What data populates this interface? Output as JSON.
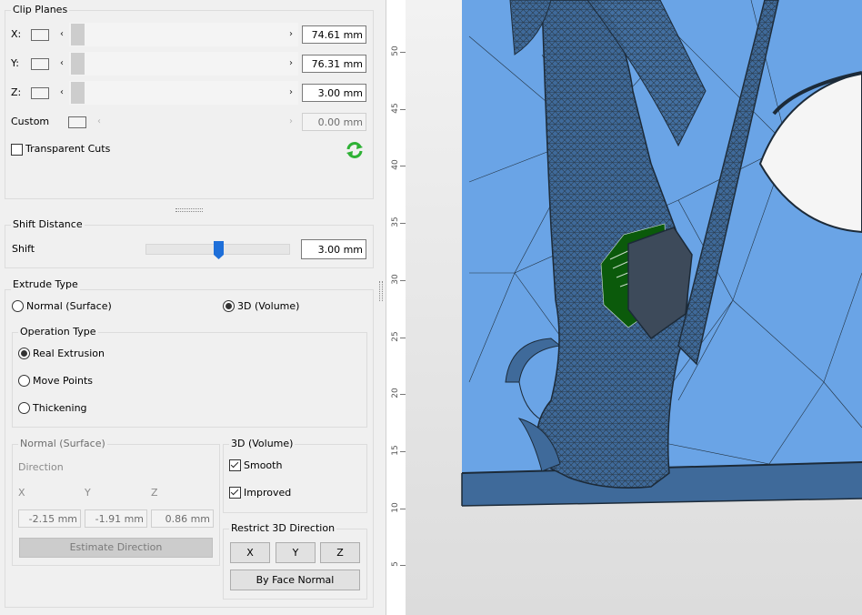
{
  "clip_planes": {
    "title": "Clip Planes",
    "rows": [
      {
        "label": "X:",
        "value": "74.61 mm"
      },
      {
        "label": "Y:",
        "value": "76.31 mm"
      },
      {
        "label": "Z:",
        "value": "3.00 mm"
      },
      {
        "label": "Custom",
        "value": "0.00 mm"
      }
    ],
    "transparent_cuts_label": "Transparent Cuts",
    "transparent_cuts_checked": false
  },
  "shift_distance": {
    "title": "Shift Distance",
    "shift_label": "Shift",
    "value": "3.00 mm"
  },
  "extrude_type": {
    "title": "Extrude Type",
    "normal_label": "Normal (Surface)",
    "volume_label": "3D (Volume)",
    "selected": "3D (Volume)"
  },
  "operation_type": {
    "title": "Operation Type",
    "options": [
      "Real Extrusion",
      "Move Points",
      "Thickening"
    ],
    "selected": "Real Extrusion"
  },
  "normal_surface": {
    "title": "Normal (Surface)",
    "direction_label": "Direction",
    "x_label": "X",
    "y_label": "Y",
    "z_label": "Z",
    "x_value": "-2.15 mm",
    "y_value": "-1.91 mm",
    "z_value": "0.86 mm",
    "estimate_label": "Estimate Direction"
  },
  "volume_options": {
    "title": "3D (Volume)",
    "smooth_label": "Smooth",
    "smooth_checked": true,
    "improved_label": "Improved",
    "improved_checked": true
  },
  "restrict_direction": {
    "title": "Restrict 3D Direction",
    "x_label": "X",
    "y_label": "Y",
    "z_label": "Z",
    "by_face_label": "By Face Normal"
  },
  "ruler": {
    "ticks": [
      "50",
      "45",
      "40",
      "35",
      "30",
      "25",
      "20",
      "15",
      "10",
      "5"
    ]
  },
  "colors": {
    "mesh_blue": "#6aa4e6",
    "mesh_dark_blue": "#3f6a9a",
    "selection_green": "#0b5a0b",
    "refresh_green": "#2eb135"
  },
  "icons": {
    "refresh": "refresh-icon",
    "left_arrow": "chevron-left-icon",
    "right_arrow": "chevron-right-icon",
    "splitter": "grip-icon"
  }
}
